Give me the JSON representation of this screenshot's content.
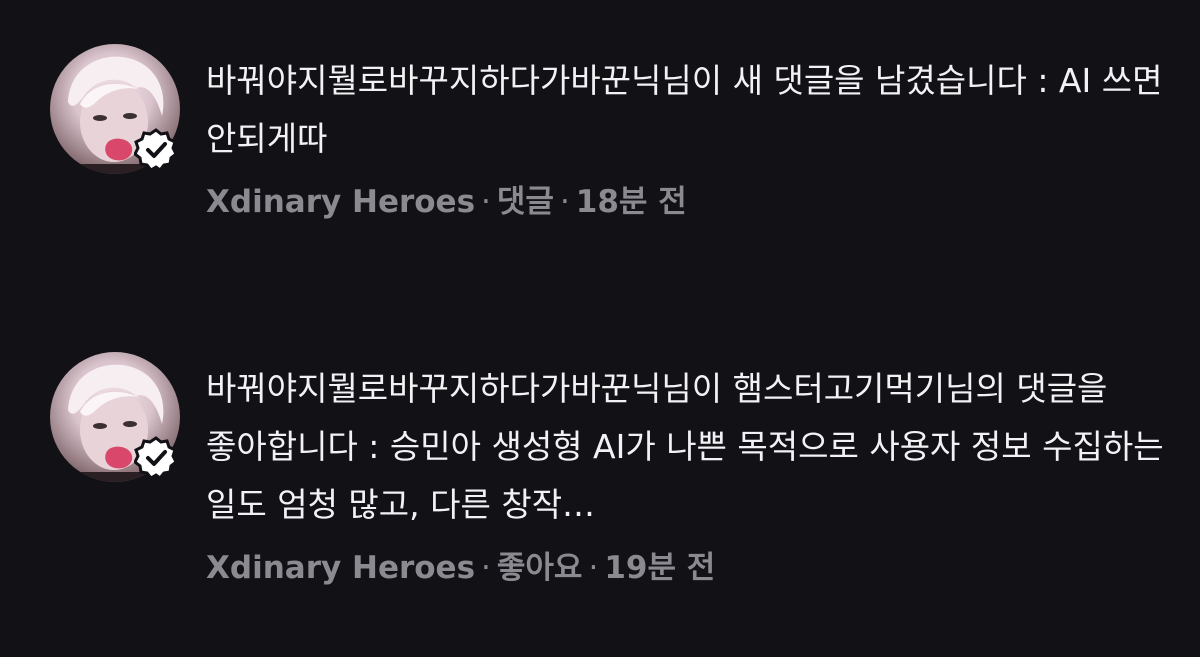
{
  "notifications": [
    {
      "message": "바꿔야지뭘로바꾸지하다가바꾼닉님이 새 댓글을 남겼습니다 : AI 쓰면 안되게따",
      "source": "Xdinary Heroes",
      "separator": "·",
      "action": "댓글",
      "time": "18분 전",
      "avatar_icon": "profile-photo",
      "badge_icon": "verified-badge-icon"
    },
    {
      "message": "바꿔야지뭘로바꾸지하다가바꾼닉님이 햄스터고기먹기님의 댓글을 좋아합니다 : 승민아 생성형 AI가 나쁜 목적으로 사용자 정보 수집하는 일도 엄청 많고, 다른 창작…",
      "source": "Xdinary Heroes",
      "separator": "·",
      "action": "좋아요",
      "time": "19분 전",
      "avatar_icon": "profile-photo",
      "badge_icon": "verified-badge-icon"
    }
  ],
  "colors": {
    "background": "#121116",
    "text_primary": "#f2f2f4",
    "text_secondary": "#8a8a90",
    "badge_fill": "#ffffff",
    "badge_check": "#121116"
  }
}
